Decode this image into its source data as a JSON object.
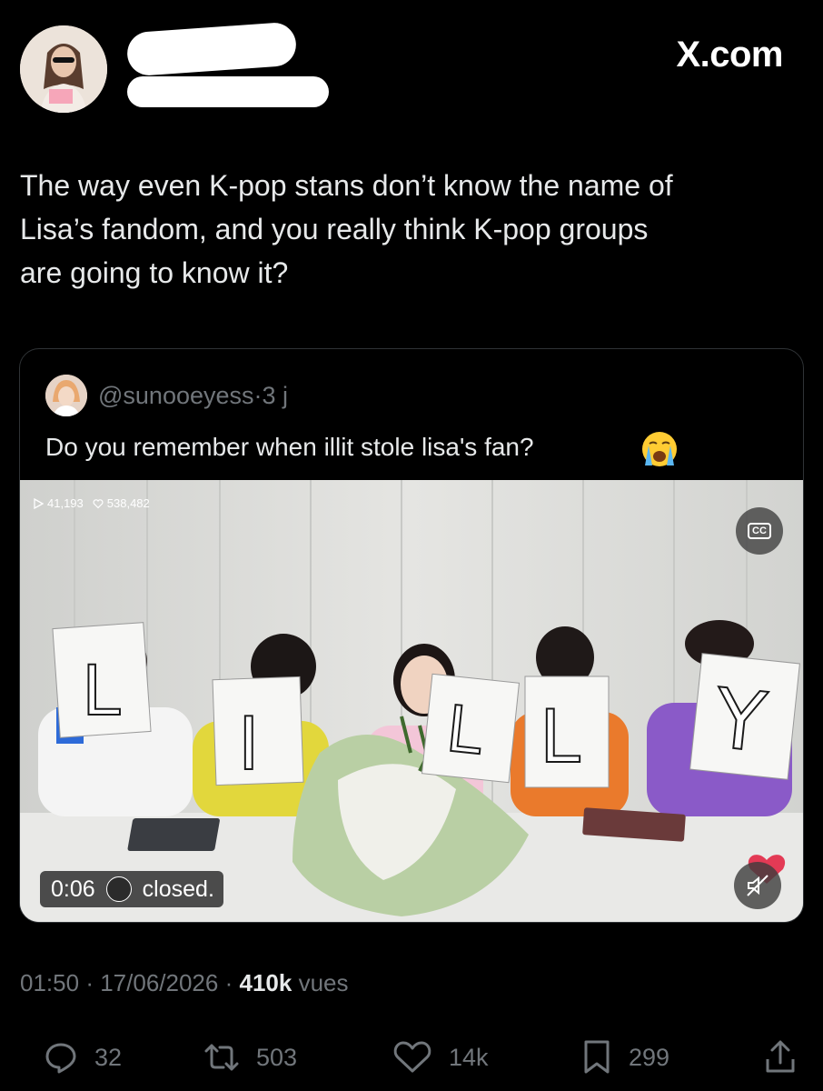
{
  "header": {
    "brand": "X.com"
  },
  "tweet": {
    "text": "The way even K-pop stans don’t know the name of\nLisa’s fandom, and you really think K-pop groups\nare going to know it?"
  },
  "quote": {
    "handle": "@sunooeyess",
    "sep": "·",
    "age": "3 j",
    "text": "Do you remember when illit stole lisa's fan?",
    "emoji_icon": "loudly-crying-face-icon"
  },
  "video": {
    "plays": "41,193",
    "likes": "538,482",
    "cc_label": "CC",
    "time": "0:06",
    "caption": "closed.",
    "signs": [
      "L",
      "I",
      "L",
      "L",
      "Y"
    ],
    "sign_badge": "LILLY"
  },
  "meta": {
    "time": "01:50",
    "sep": "·",
    "date": "17/06/2026",
    "views_count": "410k",
    "views_label": "vues"
  },
  "actions": {
    "replies": "32",
    "reposts": "503",
    "likes": "14k",
    "bookmarks": "299"
  },
  "colors": {
    "background": "#000000",
    "text": "#e7e9ea",
    "muted": "#71767b",
    "border": "#2f3336"
  }
}
